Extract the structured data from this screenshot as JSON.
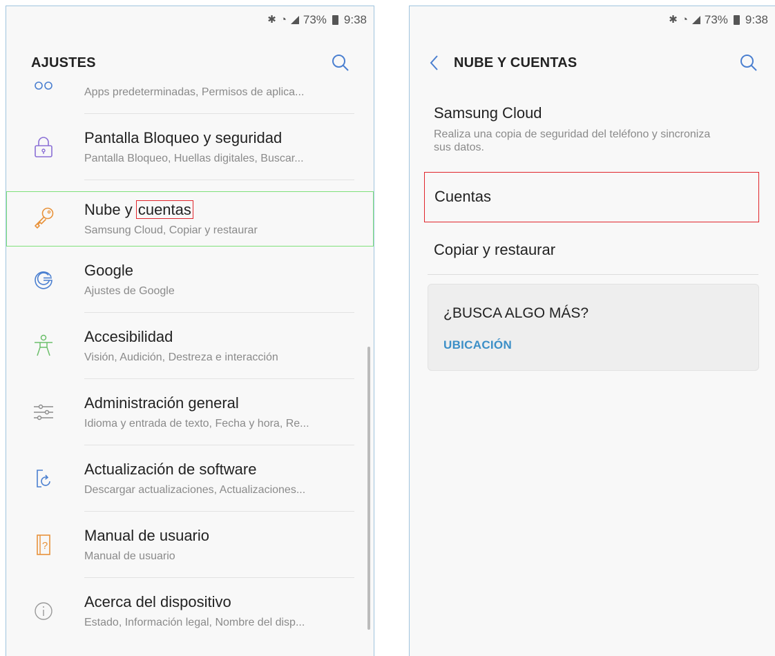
{
  "status_bar": {
    "battery": "73%",
    "time": "9:38"
  },
  "left_screen": {
    "title": "AJUSTES",
    "partial_item_subtitle": "Apps predeterminadas, Permisos de aplica...",
    "items": [
      {
        "title": "Pantalla Bloqueo y seguridad",
        "subtitle": "Pantalla Bloqueo, Huellas digitales, Buscar...",
        "icon": "lock-icon"
      },
      {
        "title_prefix": "Nube y ",
        "title_highlight": "cuentas",
        "subtitle": "Samsung Cloud, Copiar y restaurar",
        "icon": "key-icon"
      },
      {
        "title": "Google",
        "subtitle": "Ajustes de Google",
        "icon": "google-icon"
      },
      {
        "title": "Accesibilidad",
        "subtitle": "Visión, Audición, Destreza e interacción",
        "icon": "accessibility-icon"
      },
      {
        "title": "Administración general",
        "subtitle": "Idioma y entrada de texto, Fecha y hora, Re...",
        "icon": "sliders-icon"
      },
      {
        "title": "Actualización de software",
        "subtitle": "Descargar actualizaciones, Actualizaciones...",
        "icon": "update-icon"
      },
      {
        "title": "Manual de usuario",
        "subtitle": "Manual de usuario",
        "icon": "manual-icon"
      },
      {
        "title": "Acerca del dispositivo",
        "subtitle": "Estado, Información legal, Nombre del disp...",
        "icon": "info-icon"
      }
    ]
  },
  "right_screen": {
    "title": "NUBE Y CUENTAS",
    "items": [
      {
        "title": "Samsung Cloud",
        "subtitle": "Realiza una copia de seguridad del teléfono y sincroniza sus datos."
      },
      {
        "title": "Cuentas"
      },
      {
        "title": "Copiar y restaurar"
      }
    ],
    "card": {
      "question": "¿BUSCA ALGO MÁS?",
      "link": "UBICACIÓN"
    }
  },
  "colors": {
    "accent_link": "#3c8fc7",
    "highlight_red": "#e0242a",
    "highlight_green": "#7ee07a",
    "icon_blue": "#4a7fd0",
    "icon_orange": "#e8923a",
    "icon_purple": "#8a6fd6",
    "icon_green": "#6bbf6a"
  }
}
